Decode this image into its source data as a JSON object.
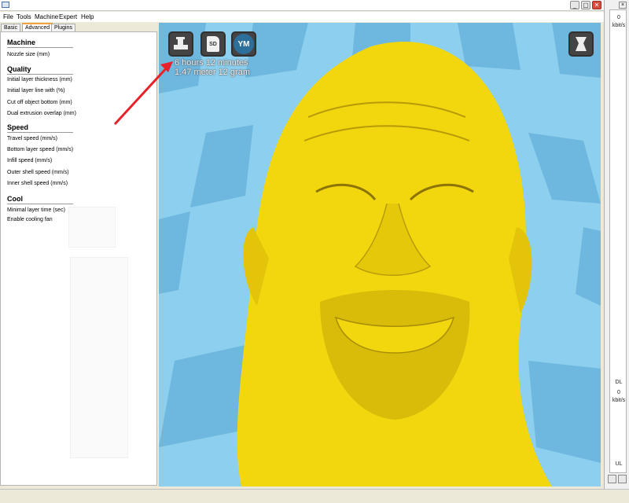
{
  "window": {
    "minimize_label": "_",
    "maximize_label": "▢",
    "close_label": "✕"
  },
  "menu": [
    "File",
    "Tools",
    "Machine",
    "Expert",
    "Help"
  ],
  "tabs": [
    "Basic",
    "Advanced",
    "Plugins"
  ],
  "active_tab": "Advanced",
  "settings": {
    "machine": {
      "title": "Machine",
      "fields": [
        "Nozzle size (mm)"
      ]
    },
    "quality": {
      "title": "Quality",
      "fields": [
        "Initial layer thickness (mm)",
        "Initial layer line with (%)",
        "Cut off object bottom (mm)",
        "Dual extrusion overlap (mm)"
      ]
    },
    "speed": {
      "title": "Speed",
      "fields": [
        "Travel speed (mm/s)",
        "Bottom layer speed (mm/s)",
        "Infill speed (mm/s)",
        "Outer shell speed (mm/s)",
        "Inner shell speed (mm/s)"
      ]
    },
    "cool": {
      "title": "Cool",
      "fields": [
        "Minimal layer time (sec)",
        "Enable cooling fan"
      ]
    }
  },
  "toolbar": {
    "sd_label": "SD",
    "ym_label": "YM",
    "print_icon": "print-to-printer-icon",
    "view_icon": "view-mode-icon"
  },
  "print_info": {
    "time": "6 hours 12 minutes",
    "material": "1.47 meter 12 gram"
  },
  "meter": {
    "top_value": "0",
    "top_unit": "kbit/s",
    "dl_label": "DL",
    "dl_value": "0",
    "dl_unit": "kbit/s",
    "ul_label": "UL"
  },
  "colors": {
    "viewport_bg": "#8dcfee",
    "model": "#f2d70e",
    "arrow": "#e8222a",
    "button": "#444444"
  }
}
